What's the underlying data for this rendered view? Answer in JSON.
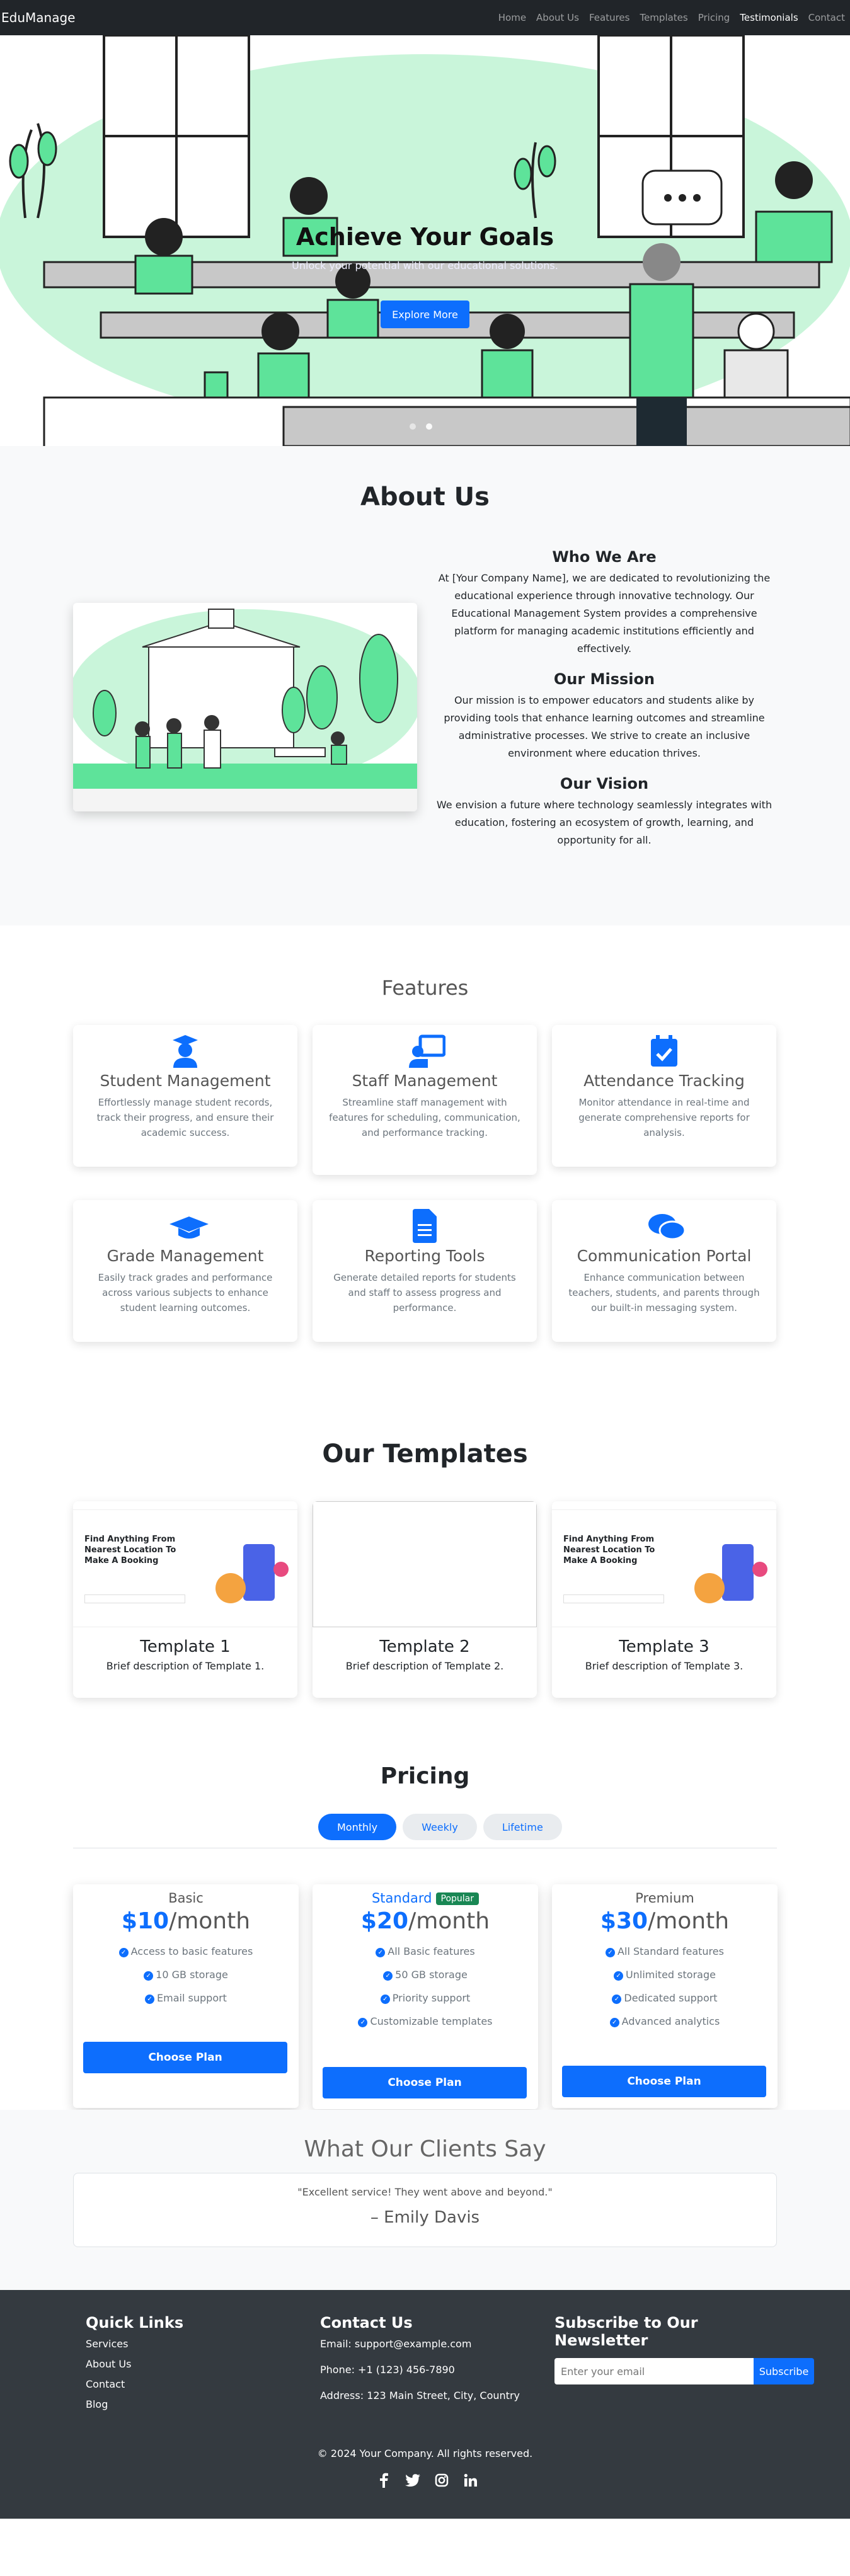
{
  "nav": {
    "brand": "EduManage",
    "links": [
      "Home",
      "About Us",
      "Features",
      "Templates",
      "Pricing",
      "Testimonials",
      "Contact"
    ],
    "active_link": "Testimonials"
  },
  "hero": {
    "title": "Achieve Your Goals",
    "subtitle": "Unlock your potential with our educational solutions.",
    "button": "Explore More"
  },
  "about": {
    "heading": "About Us",
    "blocks": [
      {
        "title": "Who We Are",
        "text": "At [Your Company Name], we are dedicated to revolutionizing the educational experience through innovative technology. Our Educational Management System provides a comprehensive platform for managing academic institutions efficiently and effectively."
      },
      {
        "title": "Our Mission",
        "text": "Our mission is to empower educators and students alike by providing tools that enhance learning outcomes and streamline administrative processes. We strive to create an inclusive environment where education thrives."
      },
      {
        "title": "Our Vision",
        "text": "We envision a future where technology seamlessly integrates with education, fostering an ecosystem of growth, learning, and opportunity for all."
      }
    ]
  },
  "features": {
    "heading": "Features",
    "items": [
      {
        "title": "Student Management",
        "text": "Effortlessly manage student records, track their progress, and ensure their academic success.",
        "icon": "user-graduate-icon"
      },
      {
        "title": "Staff Management",
        "text": "Streamline staff management with features for scheduling, communication, and performance tracking.",
        "icon": "chalkboard-teacher-icon"
      },
      {
        "title": "Attendance Tracking",
        "text": "Monitor attendance in real-time and generate comprehensive reports for analysis.",
        "icon": "calendar-check-icon"
      },
      {
        "title": "Grade Management",
        "text": "Easily track grades and performance across various subjects to enhance student learning outcomes.",
        "icon": "graduation-cap-icon"
      },
      {
        "title": "Reporting Tools",
        "text": "Generate detailed reports for students and staff to assess progress and performance.",
        "icon": "file-alt-icon"
      },
      {
        "title": "Communication Portal",
        "text": "Enhance communication between teachers, students, and parents through our built-in messaging system.",
        "icon": "comments-icon"
      }
    ]
  },
  "templates": {
    "heading": "Our Templates",
    "preview_headline": "Find Anything From Nearest Location To Make A Booking",
    "items": [
      {
        "title": "Template 1",
        "text": "Brief description of Template 1."
      },
      {
        "title": "Template 2",
        "text": "Brief description of Template 2."
      },
      {
        "title": "Template 3",
        "text": "Brief description of Template 3."
      }
    ]
  },
  "pricing": {
    "heading": "Pricing",
    "tabs": [
      "Monthly",
      "Weekly",
      "Lifetime"
    ],
    "active_tab": "Monthly",
    "per": "/month",
    "plans": [
      {
        "name": "Basic",
        "price": "$10",
        "features": [
          "Access to basic features",
          "10 GB storage",
          "Email support"
        ],
        "button": "Choose Plan"
      },
      {
        "name": "Standard",
        "badge": "Popular",
        "price": "$20",
        "features": [
          "All Basic features",
          "50 GB storage",
          "Priority support",
          "Customizable templates"
        ],
        "button": "Choose Plan"
      },
      {
        "name": "Premium",
        "price": "$30",
        "features": [
          "All Standard features",
          "Unlimited storage",
          "Dedicated support",
          "Advanced analytics"
        ],
        "button": "Choose Plan"
      }
    ]
  },
  "testimonials": {
    "heading": "What Our Clients Say",
    "quote": "\"Excellent service! They went above and beyond.\"",
    "author": "– Emily Davis"
  },
  "footer": {
    "quick_links_title": "Quick Links",
    "quick_links": [
      "Services",
      "About Us",
      "Contact",
      "Blog"
    ],
    "contact_title": "Contact Us",
    "email": "Email: support@example.com",
    "phone": "Phone: +1 (123) 456-7890",
    "address": "Address: 123 Main Street, City, Country",
    "subscribe_title": "Subscribe to Our Newsletter",
    "subscribe_placeholder": "Enter your email",
    "subscribe_button": "Subscribe",
    "copyright": "© 2024 Your Company. All rights reserved.",
    "social": [
      "facebook-icon",
      "twitter-icon",
      "instagram-icon",
      "linkedin-icon"
    ]
  },
  "colors": {
    "primary": "#0d6efd",
    "dark": "#212529",
    "footer": "#343a40",
    "illustration_green": "#5ee39a",
    "badge_green": "#198754"
  }
}
